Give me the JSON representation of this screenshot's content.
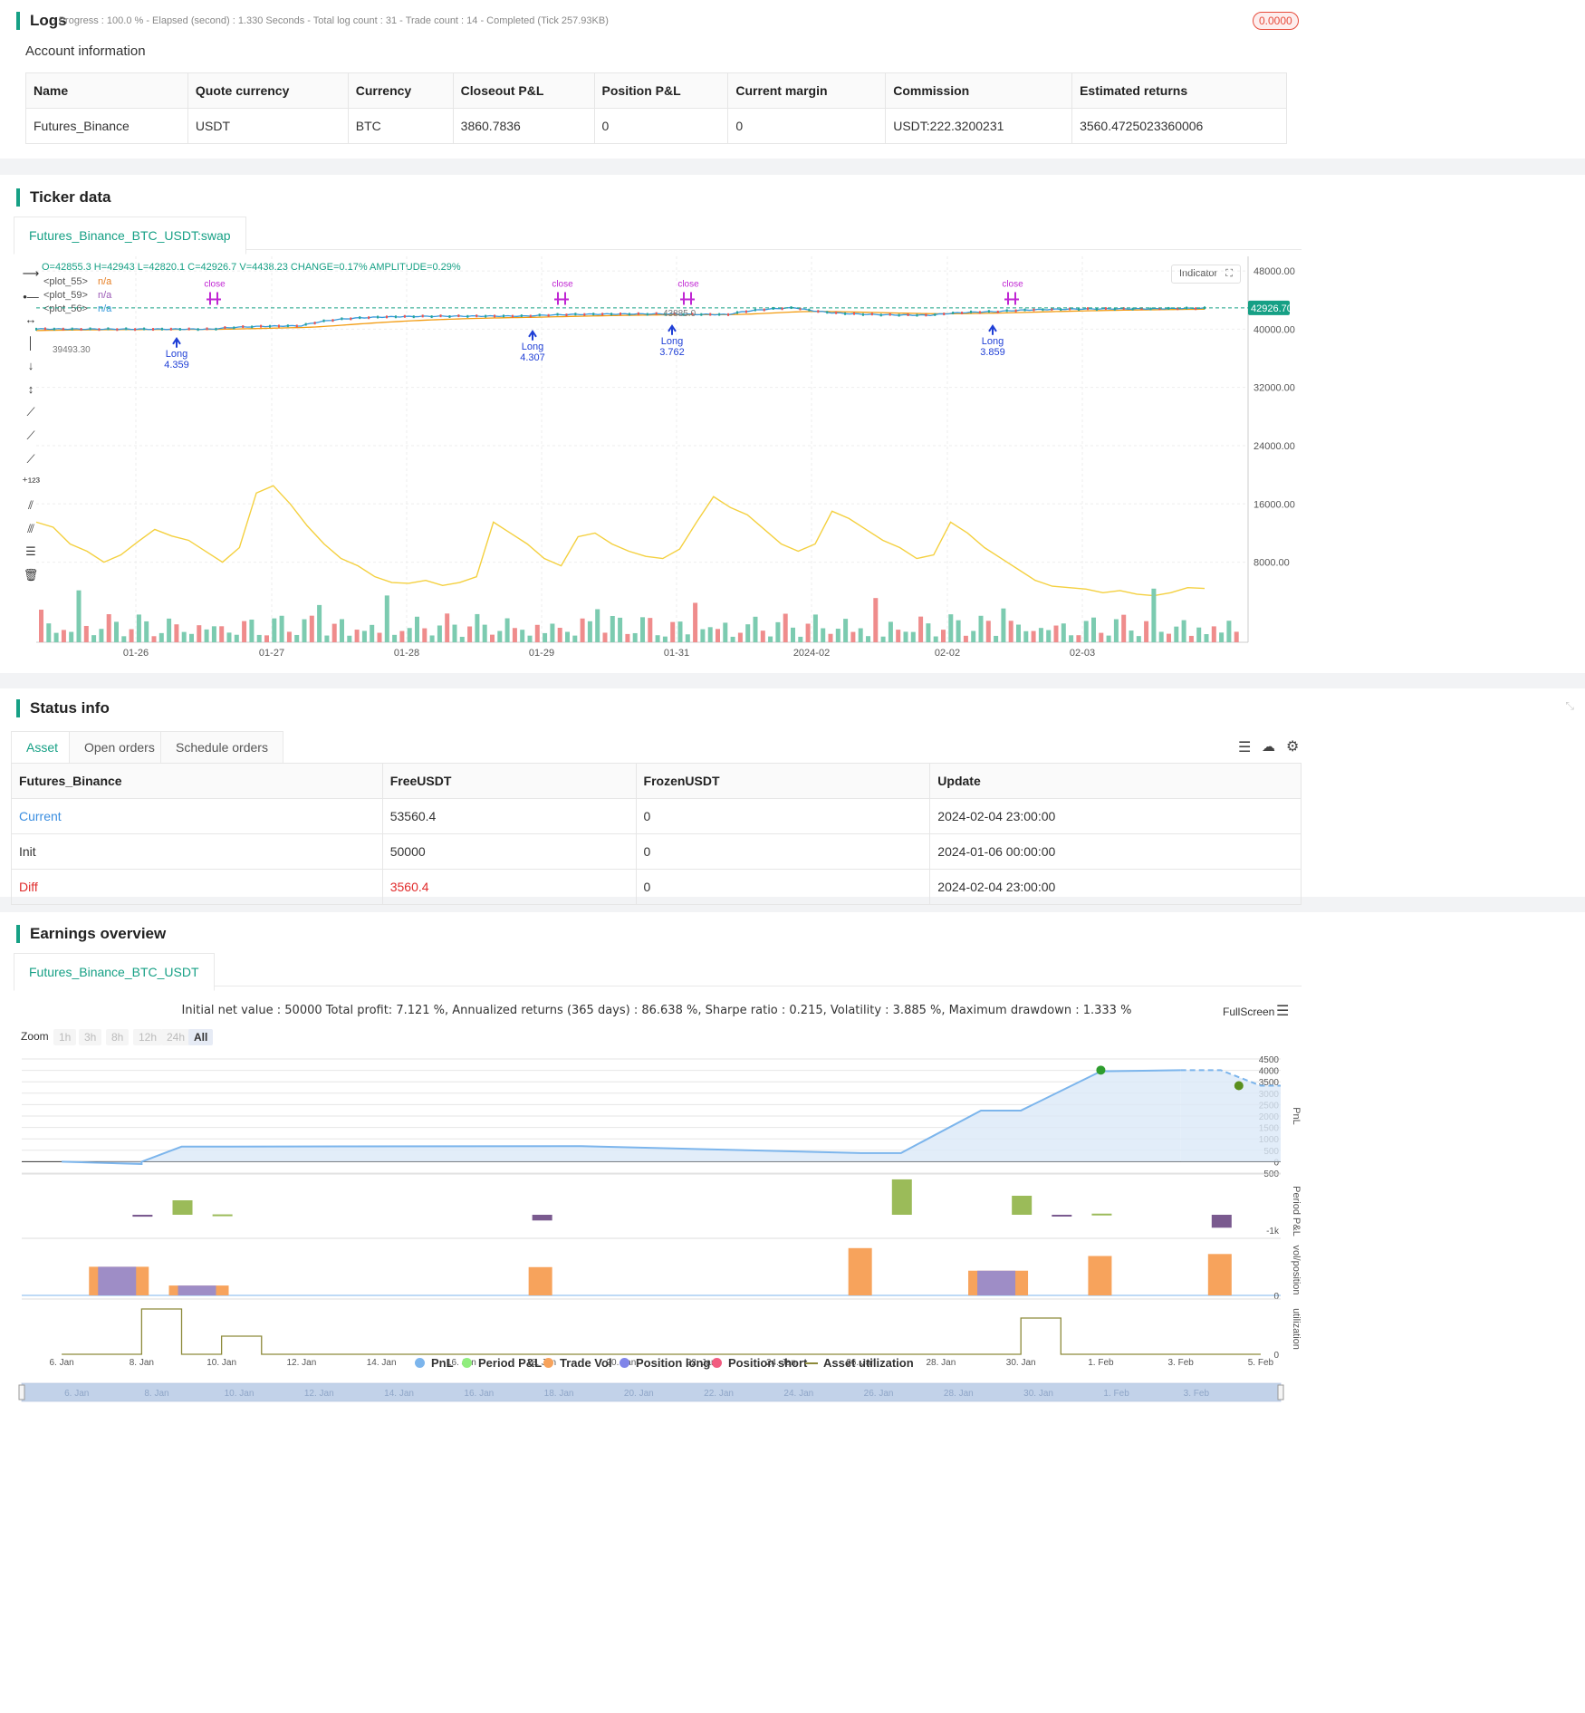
{
  "logs": {
    "title": "Logs",
    "status_text": "- Progress : 100.0 % - Elapsed (second) : 1.330 Seconds - Total log count : 31 - Trade count : 14 - Completed (Tick 257.93KB)",
    "badge": "0.0000"
  },
  "account": {
    "title": "Account information",
    "headers": [
      "Name",
      "Quote currency",
      "Currency",
      "Closeout P&L",
      "Position P&L",
      "Current margin",
      "Commission",
      "Estimated returns"
    ],
    "row": [
      "Futures_Binance",
      "USDT",
      "BTC",
      "3860.7836",
      "0",
      "0",
      "USDT:222.3200231",
      "3560.4725023360006"
    ]
  },
  "ticker": {
    "title": "Ticker data",
    "tab": "Futures_Binance_BTC_USDT:swap",
    "ohlc": "O=42855.3 H=42943 L=42820.1 C=42926.7 V=4438.23 CHANGE=0.17% AMPLITUDE=0.29%",
    "plots": [
      {
        "name": "<plot_55>",
        "value": "n/a",
        "color": "#e67e22"
      },
      {
        "name": "<plot_59>",
        "value": "n/a",
        "color": "#9b59b6"
      },
      {
        "name": "<plot_56>",
        "value": "n/a",
        "color": "#3498db"
      }
    ],
    "indicator_label": "Indicator",
    "last_price": "42926.70",
    "y_ticks": [
      "48000.00",
      "40000.00",
      "32000.00",
      "24000.00",
      "16000.00",
      "8000.00"
    ],
    "x_ticks": [
      "01-26",
      "01-27",
      "01-28",
      "01-29",
      "01-31",
      "2024-02",
      "02-02",
      "02-03"
    ],
    "low_marker": "39493.30",
    "high_marker": "43885.0",
    "trades": [
      {
        "label": "Long",
        "value": "4.359"
      },
      {
        "label": "Long",
        "value": "4.307"
      },
      {
        "label": "Long",
        "value": "3.762"
      },
      {
        "label": "Long",
        "value": "3.859"
      }
    ],
    "close_labels": [
      "close",
      "close",
      "close",
      "close"
    ]
  },
  "status": {
    "title": "Status info",
    "tabs": [
      "Asset",
      "Open orders",
      "Schedule orders"
    ],
    "headers": [
      "Futures_Binance",
      "FreeUSDT",
      "FrozenUSDT",
      "Update"
    ],
    "rows": [
      [
        "Current",
        "53560.4",
        "0",
        "2024-02-04 23:00:00"
      ],
      [
        "Init",
        "50000",
        "0",
        "2024-01-06 00:00:00"
      ],
      [
        "Diff",
        "3560.4",
        "0",
        "2024-02-04 23:00:00"
      ]
    ]
  },
  "earnings": {
    "title": "Earnings overview",
    "tab": "Futures_Binance_BTC_USDT",
    "summary": "Initial net value : 50000 Total profit: 7.121 %, Annualized returns (365 days) : 86.638 %, Sharpe ratio : 0.215, Volatility : 3.885 %, Maximum drawdown : 1.333 %",
    "fullscreen": "FullScreen",
    "zoom_label": "Zoom",
    "zoom_buttons": [
      "1h",
      "3h",
      "8h",
      "12h",
      "24h",
      "All"
    ],
    "pnl_ticks": [
      "4500",
      "4000",
      "3500",
      "3000",
      "2500",
      "2000",
      "1500",
      "1000",
      "500",
      "0",
      "-500"
    ],
    "axis_titles": [
      "PnL",
      "Period P&L",
      "vol/position",
      "utilization"
    ],
    "period_tick": "-1k",
    "vol_tick": "0",
    "util_tick": "0",
    "x_ticks": [
      "6. Jan",
      "8. Jan",
      "10. Jan",
      "12. Jan",
      "14. Jan",
      "16. Jan",
      "18. Jan",
      "20. Jan",
      "22. Jan",
      "24. Jan",
      "26. Jan",
      "28. Jan",
      "30. Jan",
      "1. Feb",
      "3. Feb",
      "5. Feb"
    ],
    "legend": [
      {
        "name": "PnL",
        "color": "#7cb5ec"
      },
      {
        "name": "Period P&L",
        "color": "#90ed7d"
      },
      {
        "name": "Trade Vol",
        "color": "#f7a35c"
      },
      {
        "name": "Position long",
        "color": "#8085e9"
      },
      {
        "name": "Position short",
        "color": "#f15c80"
      },
      {
        "name": "Asset utilization",
        "color": "#8d8a3a"
      }
    ],
    "nav_ticks": [
      "6. Jan",
      "8. Jan",
      "10. Jan",
      "12. Jan",
      "14. Jan",
      "16. Jan",
      "18. Jan",
      "20. Jan",
      "22. Jan",
      "24. Jan",
      "26. Jan",
      "28. Jan",
      "30. Jan",
      "1. Feb",
      "3. Feb"
    ]
  },
  "chart_data": [
    {
      "type": "line",
      "title": "",
      "series": [
        {
          "name": "PnL",
          "x": [
            "2024-01-06",
            "2024-01-08",
            "2024-01-08",
            "2024-01-09",
            "2024-01-19",
            "2024-01-26",
            "2024-01-27",
            "2024-01-29",
            "2024-01-30",
            "2024-02-01",
            "2024-02-03",
            "2024-02-04",
            "2024-02-05"
          ],
          "values": [
            0,
            -100,
            0,
            660,
            680,
            380,
            380,
            2240,
            2240,
            3960,
            4010,
            4010,
            3330
          ]
        }
      ],
      "ylim": [
        -500,
        4500
      ]
    },
    {
      "type": "bar",
      "title": "",
      "series": [
        {
          "name": "Period P&L",
          "x": [
            "2024-01-08",
            "2024-01-09",
            "2024-01-10",
            "2024-01-18",
            "2024-01-27",
            "2024-01-30",
            "2024-01-31",
            "2024-02-01",
            "2024-02-04"
          ],
          "values": [
            -100,
            760,
            20,
            -300,
            1860,
            1000,
            -10,
            60,
            -680
          ]
        }
      ]
    },
    {
      "type": "bar",
      "title": "",
      "series": [
        {
          "name": "Trade Vol",
          "x": [
            "2024-01-07",
            "2024-01-09",
            "2024-01-18",
            "2024-01-26",
            "2024-01-29",
            "2024-02-01",
            "2024-02-04"
          ],
          "values": [
            4.359,
            1.5,
            4.307,
            7.2,
            3.762,
            6.0,
            6.3
          ]
        },
        {
          "name": "Position long",
          "x": [
            "2024-01-07",
            "2024-01-09",
            "2024-01-29"
          ],
          "values": [
            4.359,
            1.5,
            3.762
          ]
        }
      ]
    },
    {
      "type": "line",
      "title": "",
      "series": [
        {
          "name": "Asset utilization",
          "x": [
            "2024-01-06",
            "2024-01-08",
            "2024-01-09",
            "2024-01-10",
            "2024-01-11",
            "2024-01-30",
            "2024-01-31",
            "2024-02-05"
          ],
          "values": [
            0,
            1,
            0,
            0.4,
            0,
            0.8,
            0,
            0
          ]
        }
      ]
    }
  ]
}
